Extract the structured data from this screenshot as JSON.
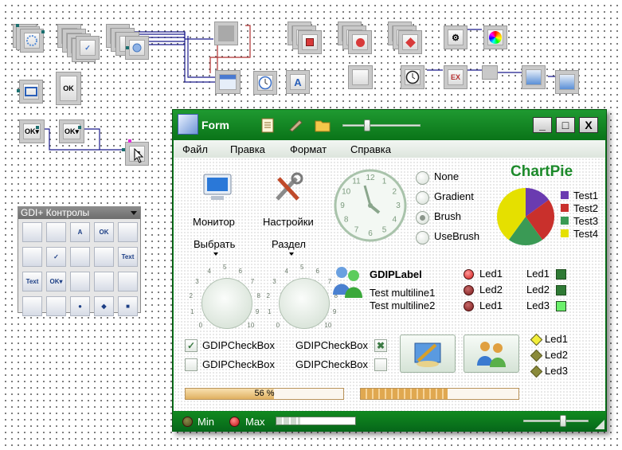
{
  "canvas": {
    "node_icons": [
      "circle-progress-icon",
      "checkbox-icon",
      "radio-icon",
      "panel-icon",
      "record-icon",
      "diamond-icon",
      "tree-icon",
      "colorwheel-icon",
      "form-icon",
      "clock-icon",
      "label-icon",
      "ex-icon",
      "button-icon"
    ],
    "nodes": {
      "ok1": "OK",
      "ok2": "OK▾",
      "ok3": "OK▾",
      "ex": "EX"
    }
  },
  "palette": {
    "title": "GDI+ Контролы",
    "cells": [
      "",
      "",
      "A",
      "OK",
      "",
      "",
      "✓",
      "",
      "",
      "Text",
      "Text",
      "OK▾",
      "",
      "",
      "",
      " ",
      "",
      "●",
      "◆",
      "■"
    ]
  },
  "form": {
    "title": "Form",
    "buttons": {
      "minimize": "_",
      "maximize": "□",
      "close": "X"
    },
    "menu": [
      "Файл",
      "Правка",
      "Формат",
      "Справка"
    ],
    "icons": [
      {
        "label": "Монитор"
      },
      {
        "label": "Настройки"
      }
    ],
    "dropdowns": [
      "Выбрать",
      "Раздел"
    ],
    "clock_numbers": [
      "12",
      "1",
      "2",
      "3",
      "4",
      "5",
      "6",
      "7",
      "8",
      "9",
      "10",
      "11"
    ],
    "radios": [
      {
        "label": "None",
        "selected": false
      },
      {
        "label": "Gradient",
        "selected": false
      },
      {
        "label": "Brush",
        "selected": true
      },
      {
        "label": "UseBrush",
        "selected": false
      }
    ],
    "chart_title": "ChartPie",
    "knob_numbers": [
      "0",
      "1",
      "2",
      "3",
      "4",
      "5",
      "6",
      "7",
      "8",
      "9",
      "10"
    ],
    "gdip_label": {
      "title": "GDIPLabel",
      "line1": "Test multiline1",
      "line2": "Test multiline2"
    },
    "leds_red": [
      "Led1",
      "Led2",
      "Led1"
    ],
    "leds_green": [
      "Led1",
      "Led2",
      "Led3"
    ],
    "leds_diamond": [
      "Led1",
      "Led2",
      "Led3"
    ],
    "checkboxes": [
      {
        "label": "GDIPCheckBox",
        "checked": true
      },
      {
        "label": "GDIPCheckBox",
        "checked": false
      },
      {
        "label": "GDIPCheckBox",
        "checked": true
      },
      {
        "label": "GDIPCheckBox",
        "checked": false
      }
    ],
    "progress1": {
      "text": "56 %",
      "value": 0.56
    },
    "progress2": {
      "value": 0.55
    },
    "status": {
      "min_label": "Min",
      "max_label": "Max",
      "progress": 0.3
    },
    "colors": {
      "green": "#0b7d1d",
      "chart_title": "#1c8a2a"
    }
  },
  "chart_data": {
    "type": "pie",
    "title": "ChartPie",
    "categories": [
      "Test1",
      "Test2",
      "Test3",
      "Test4"
    ],
    "values": [
      15,
      25,
      20,
      40
    ],
    "colors": [
      "#6a3bb0",
      "#c9302c",
      "#3a9a55",
      "#e5e000"
    ],
    "legend": "right"
  }
}
